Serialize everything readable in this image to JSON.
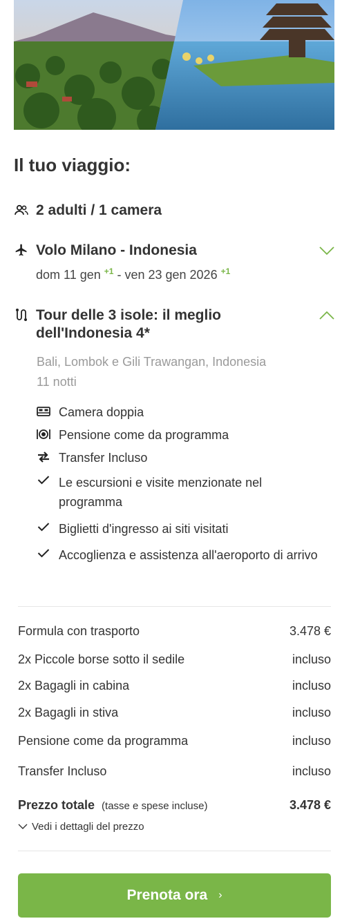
{
  "heading": "Il tuo viaggio:",
  "guests": {
    "icon": "people-icon",
    "label": "2 adulti / 1 camera"
  },
  "flight": {
    "icon": "airplane-icon",
    "title": "Volo Milano - Indonesia",
    "depart": "dom 11 gen",
    "depart_plus": "+1",
    "separator": " - ",
    "return": "ven 23 gen 2026",
    "return_plus": "+1"
  },
  "tour": {
    "icon": "route-icon",
    "title_line1": "Tour delle 3 isole: il meglio",
    "title_line2": "dell'Indonesia 4*",
    "location": "Bali, Lombok e Gili Trawangan, Indonesia",
    "nights": "11 notti",
    "inclusions": [
      {
        "icon": "bed-icon",
        "text": "Camera doppia"
      },
      {
        "icon": "dining-icon",
        "text": "Pensione come da programma"
      },
      {
        "icon": "transfer-arrows-icon",
        "text": "Transfer Incluso"
      },
      {
        "icon": "checkmark-icon",
        "text": "Le escursioni e visite menzionate nel programma"
      },
      {
        "icon": "checkmark-icon",
        "text": "Biglietti d'ingresso ai siti visitati"
      },
      {
        "icon": "checkmark-icon",
        "text": "Accoglienza e assistenza all'aeroporto di arrivo"
      }
    ]
  },
  "price_lines": [
    {
      "label": "Formula con trasporto",
      "value": "3.478 €"
    },
    {
      "label": "2x Piccole borse sotto il sedile",
      "value": "incluso"
    },
    {
      "label": "2x Bagagli in cabina",
      "value": "incluso"
    },
    {
      "label": "2x Bagagli in stiva",
      "value": "incluso"
    },
    {
      "label": "Pensione come da programma",
      "value": "incluso"
    },
    {
      "label": "Transfer Incluso",
      "value": "incluso"
    }
  ],
  "total": {
    "label": "Prezzo totale",
    "note": "(tasse e spese incluse)",
    "value": "3.478 €",
    "details_link": "Vedi i dettagli del prezzo"
  },
  "book_button": "Prenota ora",
  "colors": {
    "accent": "#7ab648",
    "text": "#333333",
    "muted": "#9a9a9a"
  }
}
